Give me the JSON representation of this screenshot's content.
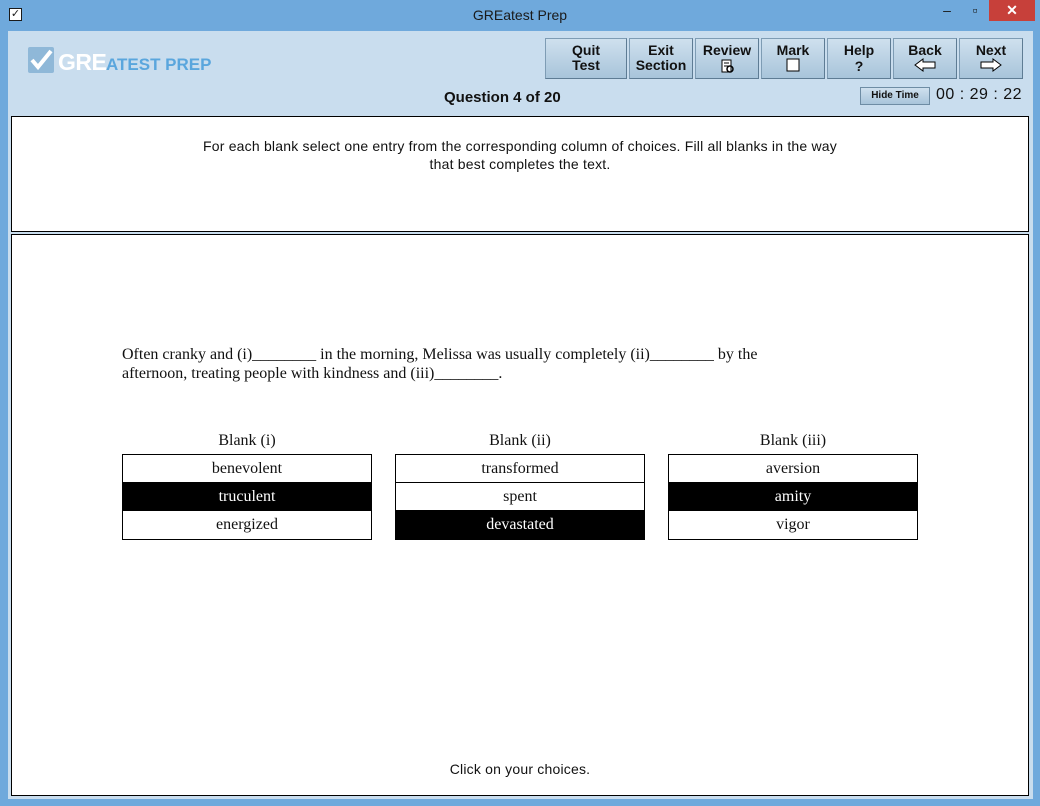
{
  "window": {
    "title": "GREatest Prep",
    "icons": {
      "app": "checkbox-icon",
      "minimize": "minimize-icon",
      "maximize": "maximize-icon",
      "close": "close-icon"
    }
  },
  "logo": {
    "gre": "GRE",
    "rest": "ATEST PREP"
  },
  "toolbar": {
    "quit": [
      "Quit",
      "Test"
    ],
    "exit": [
      "Exit",
      "Section"
    ],
    "review": "Review",
    "mark": "Mark",
    "help": "Help",
    "back": "Back",
    "next": "Next"
  },
  "question_header": "Question 4 of 20",
  "hide_time_label": "Hide Time",
  "timer": "00 : 29 : 22",
  "instructions": {
    "line1": "For each blank select one entry from the corresponding column of choices. Fill all blanks in the way",
    "line2": "that best completes the text."
  },
  "sentence": {
    "line1": "Often cranky and (i)________ in the morning, Melissa was usually completely (ii)________ by the",
    "line2": "afternoon, treating people with kindness and (iii)________."
  },
  "blanks": [
    {
      "header": "Blank (i)",
      "choices": [
        "benevolent",
        "truculent",
        "energized"
      ],
      "selected": 1
    },
    {
      "header": "Blank (ii)",
      "choices": [
        "transformed",
        "spent",
        "devastated"
      ],
      "selected": 2
    },
    {
      "header": "Blank (iii)",
      "choices": [
        "aversion",
        "amity",
        "vigor"
      ],
      "selected": 1
    }
  ],
  "footer_note": "Click on your choices."
}
